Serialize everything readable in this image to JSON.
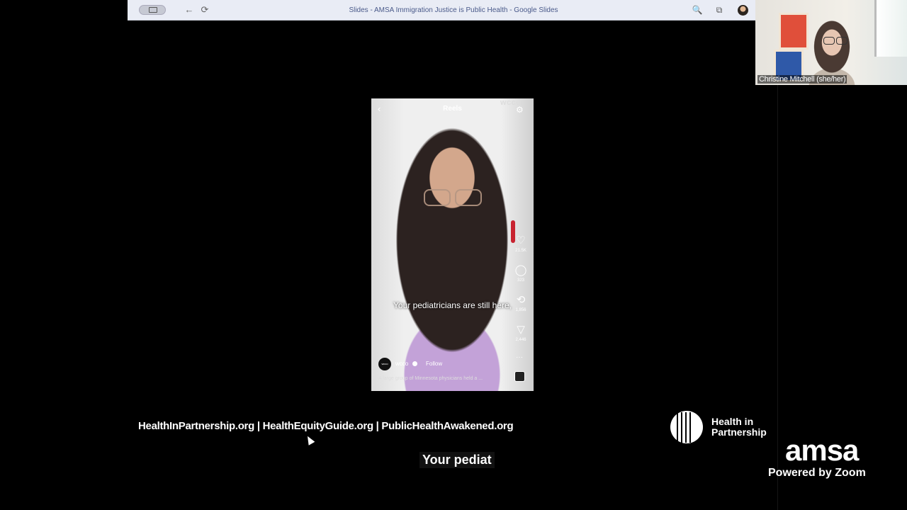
{
  "browser": {
    "title": "Slides - AMSA Immigration Justice is Public Health - Google Slides",
    "nav": {
      "back": "←",
      "reload": "⟳"
    },
    "right_icons": {
      "zoom": "🔍",
      "extension": "⧉"
    }
  },
  "reel": {
    "header": "Reels",
    "back": "‹",
    "watermark": "wcco",
    "filter": "⚙",
    "caption": "Your pediatricians are still here,",
    "likes": {
      "icon": "♡",
      "count": "21.5K"
    },
    "comments": {
      "icon": "◯",
      "count": "323"
    },
    "reposts": {
      "icon": "⟲",
      "count": "1,856"
    },
    "shares": {
      "icon": "▽",
      "count": "2,446"
    },
    "more": "···",
    "account": "wcco",
    "account_avatar": "wcco",
    "follow": "Follow",
    "description": "A large group of Minnesota physicians held a ..."
  },
  "slide": {
    "links": "HealthInPartnership.org | HealthEquityGuide.org | PublicHealthAwakened.org",
    "logo_line1": "Health in",
    "logo_line2": "Partnership"
  },
  "live_caption": "Your pediat",
  "branding": {
    "amsa": "amsa",
    "powered_by": "Powered by Zoom"
  },
  "participant": {
    "name": "Christine Mitchell (she/her)"
  },
  "colors": {
    "background": "#000000",
    "browser_bar": "#e9ecf5",
    "title_text": "#4a5a8a",
    "shirt": "#c3a2d8"
  }
}
